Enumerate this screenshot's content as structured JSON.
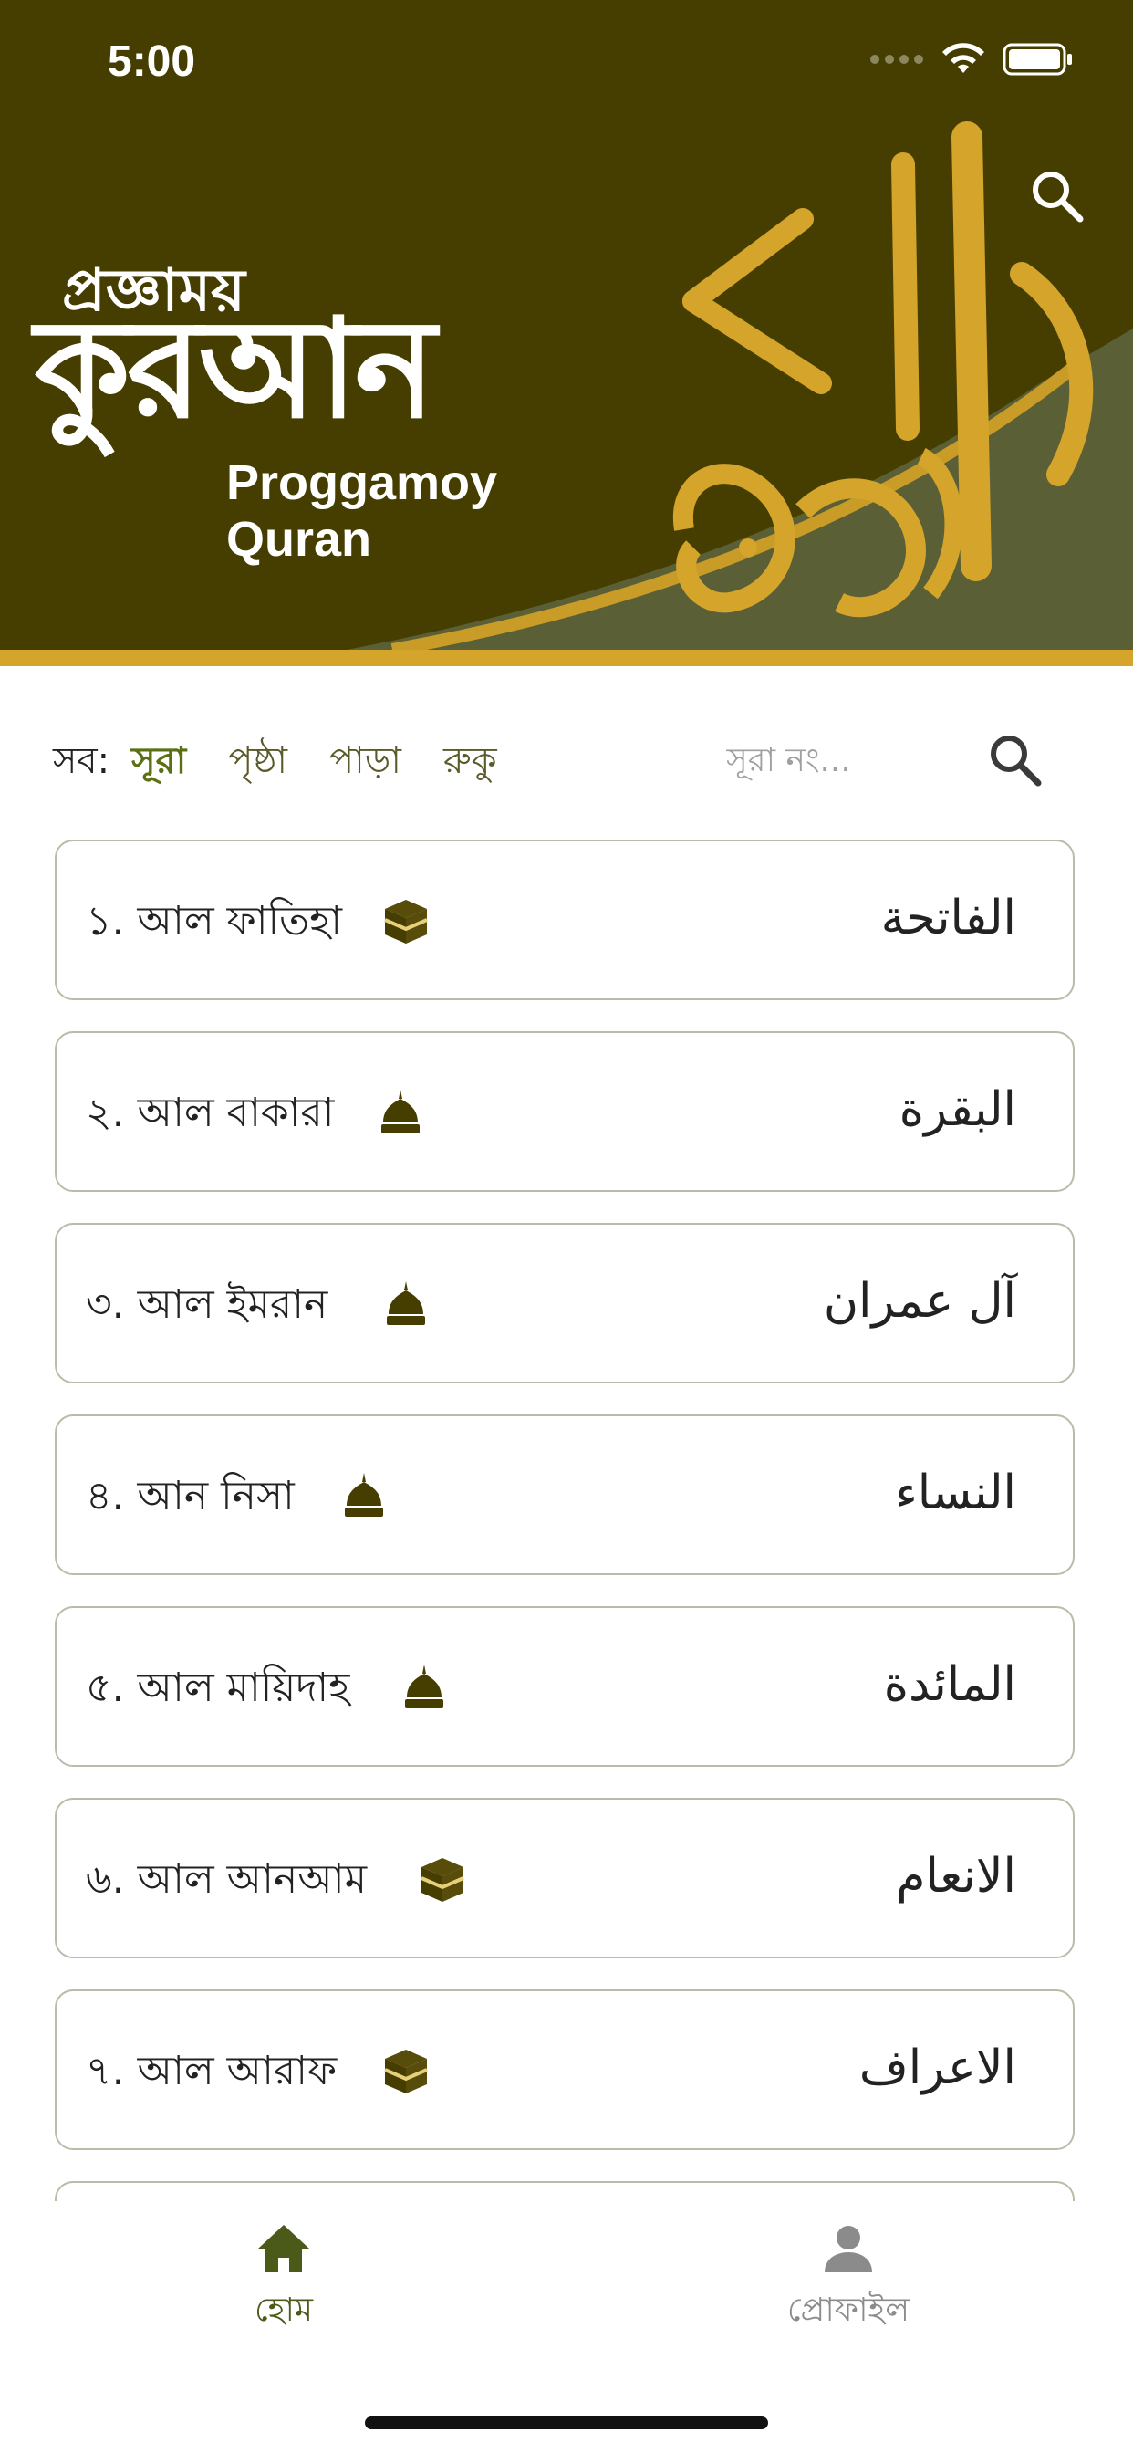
{
  "status_bar": {
    "time": "5:00"
  },
  "header": {
    "logo_small": "প্রজ্ঞাময়",
    "logo_big": "কুরআন",
    "logo_en": "Proggamoy Quran"
  },
  "filter": {
    "label": "সব:",
    "tabs": [
      "সূরা",
      "পৃষ্ঠা",
      "পাড়া",
      "রুকু"
    ],
    "active_tab": "সূরা",
    "search_placeholder": "সূরা নং..."
  },
  "surahs": [
    {
      "title": "১. আল ফাতিহা",
      "arabic": "الفاتحة",
      "type_icon": "kaaba-icon"
    },
    {
      "title": "২. আল বাকারা",
      "arabic": "البقرة",
      "type_icon": "mosque-icon"
    },
    {
      "title": "৩. আল ইমরান",
      "arabic": "آل عمران",
      "type_icon": "mosque-icon"
    },
    {
      "title": "৪. আন নিসা",
      "arabic": "النساء",
      "type_icon": "mosque-icon"
    },
    {
      "title": "৫. আল মায়িদাহ",
      "arabic": "المائدة",
      "type_icon": "mosque-icon"
    },
    {
      "title": "৬. আল আনআম",
      "arabic": "الانعام",
      "type_icon": "kaaba-icon"
    },
    {
      "title": "৭. আল আরাফ",
      "arabic": "الاعراف",
      "type_icon": "kaaba-icon"
    }
  ],
  "bottom_nav": {
    "home_label": "হোম",
    "profile_label": "প্রোফাইল"
  },
  "colors": {
    "header_bg": "#463e00",
    "gold": "#d4a52a",
    "olive": "#4b5a18",
    "card_border": "#bcbba8"
  }
}
